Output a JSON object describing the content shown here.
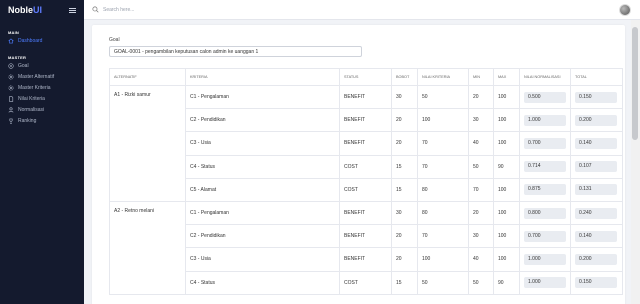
{
  "brand": {
    "name": "Noble",
    "accent": "UI"
  },
  "search": {
    "placeholder": "Search here..."
  },
  "sidebar": {
    "main_label": "MAIN",
    "master_label": "MASTER",
    "items": [
      {
        "label": "Dashboard",
        "icon": "home-icon",
        "active": true
      },
      {
        "label": "Goal",
        "icon": "target-icon",
        "active": false
      },
      {
        "label": "Master Alternatif",
        "icon": "settings-icon",
        "active": false
      },
      {
        "label": "Master Kriteria",
        "icon": "settings-icon",
        "active": false
      },
      {
        "label": "Nilai Kriteria",
        "icon": "document-icon",
        "active": false
      },
      {
        "label": "Normalisasi",
        "icon": "user-icon",
        "active": false
      },
      {
        "label": "Ranking",
        "icon": "trophy-icon",
        "active": false
      }
    ]
  },
  "goal": {
    "label": "Goal",
    "value": "GOAL-0001 - pengambilan keputusan calon admin ke uanggan 1"
  },
  "table": {
    "headers": [
      "ALTERNATIF",
      "KRITERIA",
      "STATUS",
      "BOBOT",
      "NILAI KRITERIA",
      "MIN",
      "MAX",
      "NILAI NORMALISASI",
      "TOTAL"
    ],
    "groups": [
      {
        "alternatif": "A1 - Rizki samur",
        "rows": [
          {
            "kriteria": "C1 - Pengalaman",
            "status": "BENEFIT",
            "bobot": "30",
            "nilai": "50",
            "min": "20",
            "max": "100",
            "normalisasi": "0.500",
            "total": "0.150"
          },
          {
            "kriteria": "C2 - Pendidikan",
            "status": "BENEFIT",
            "bobot": "20",
            "nilai": "100",
            "min": "30",
            "max": "100",
            "normalisasi": "1.000",
            "total": "0.200"
          },
          {
            "kriteria": "C3 - Usia",
            "status": "BENEFIT",
            "bobot": "20",
            "nilai": "70",
            "min": "40",
            "max": "100",
            "normalisasi": "0.700",
            "total": "0.140"
          },
          {
            "kriteria": "C4 - Status",
            "status": "COST",
            "bobot": "15",
            "nilai": "70",
            "min": "50",
            "max": "90",
            "normalisasi": "0.714",
            "total": "0.107"
          },
          {
            "kriteria": "C5 - Alamat",
            "status": "COST",
            "bobot": "15",
            "nilai": "80",
            "min": "70",
            "max": "100",
            "normalisasi": "0.875",
            "total": "0.131"
          }
        ]
      },
      {
        "alternatif": "A2 - Retno melani",
        "rows": [
          {
            "kriteria": "C1 - Pengalaman",
            "status": "BENEFIT",
            "bobot": "30",
            "nilai": "80",
            "min": "20",
            "max": "100",
            "normalisasi": "0.800",
            "total": "0.240"
          },
          {
            "kriteria": "C2 - Pendidikan",
            "status": "BENEFIT",
            "bobot": "20",
            "nilai": "70",
            "min": "30",
            "max": "100",
            "normalisasi": "0.700",
            "total": "0.140"
          },
          {
            "kriteria": "C3 - Usia",
            "status": "BENEFIT",
            "bobot": "20",
            "nilai": "100",
            "min": "40",
            "max": "100",
            "normalisasi": "1.000",
            "total": "0.200"
          },
          {
            "kriteria": "C4 - Status",
            "status": "COST",
            "bobot": "15",
            "nilai": "50",
            "min": "50",
            "max": "90",
            "normalisasi": "1.000",
            "total": "0.150"
          }
        ]
      }
    ]
  }
}
